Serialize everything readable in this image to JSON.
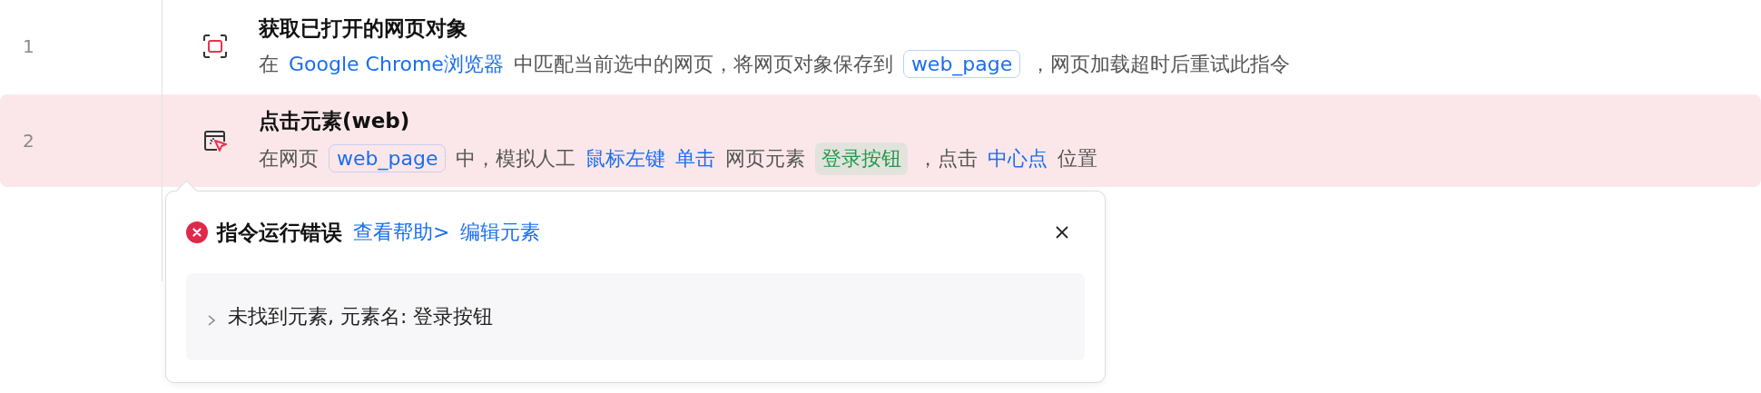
{
  "rows": [
    {
      "number": "1",
      "kind": "capture",
      "title": "获取已打开的网页对象",
      "error": false,
      "segments": [
        {
          "kind": "text",
          "text": "在"
        },
        {
          "kind": "link",
          "text": "Google Chrome浏览器"
        },
        {
          "kind": "text",
          "text": "中匹配当前选中的网页，将网页对象保存到"
        },
        {
          "kind": "variable",
          "text": "web_page"
        },
        {
          "kind": "text",
          "text": "，网页加载超时后重试此指令"
        }
      ]
    },
    {
      "number": "2",
      "kind": "click",
      "title": "点击元素(web)",
      "error": true,
      "segments": [
        {
          "kind": "text",
          "text": "在网页"
        },
        {
          "kind": "variable",
          "text": "web_page"
        },
        {
          "kind": "text",
          "text": "中，模拟人工"
        },
        {
          "kind": "link",
          "text": "鼠标左键"
        },
        {
          "kind": "link",
          "text": "单击"
        },
        {
          "kind": "text",
          "text": "网页元素"
        },
        {
          "kind": "element",
          "text": "登录按钮"
        },
        {
          "kind": "text",
          "text": "，点击"
        },
        {
          "kind": "link",
          "text": "中心点"
        },
        {
          "kind": "text",
          "text": "位置"
        }
      ]
    }
  ],
  "error_popup": {
    "title": "指令运行错误",
    "links": [
      "查看帮助>",
      "编辑元素"
    ],
    "detail": {
      "text": "未找到元素, 元素名: 登录按钮",
      "expanded": false
    }
  }
}
